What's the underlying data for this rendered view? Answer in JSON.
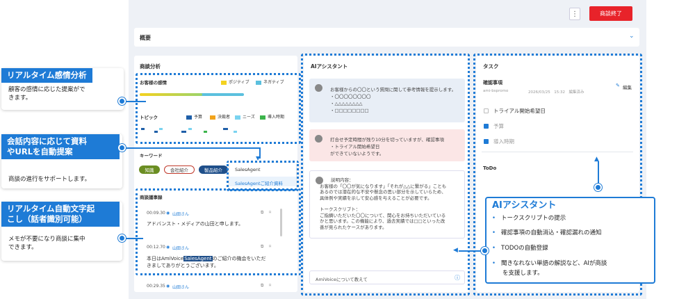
{
  "header": {
    "end_button": "商談終了",
    "overview_title": "概要"
  },
  "analysis": {
    "title": "商談分析",
    "emotion_label": "お客様の感情",
    "legend_positive": "ポジティブ",
    "legend_negative": "ネガティブ",
    "topic_label": "トピック",
    "topic_legend": [
      "予算",
      "決裁者",
      "ニーズ",
      "導入時期"
    ],
    "keyword_label": "キーワード",
    "chips": [
      "知識",
      "会社紹介",
      "製品紹介"
    ],
    "dropdown": [
      "SalesAgent",
      "SalesAgentご紹介資料"
    ]
  },
  "minutes": {
    "title": "商談議事録",
    "entries": [
      {
        "time": "00:09.30",
        "speaker": "山田さん",
        "text": "アドバンスト・メディアの山田と申します。"
      },
      {
        "time": "00:12.70",
        "speaker": "山田さん",
        "text_before": "本日はAmiVoice",
        "highlight": "SalesAgent",
        "text_after": "のご紹介の機会をいただ",
        "text2": "きましてありがとうございます。"
      },
      {
        "time": "00:29.35",
        "speaker": "山田さん"
      }
    ]
  },
  "assistant": {
    "title": "AIアシスタント",
    "msg1": [
      "お客様からの〇〇という質問に関して参考情報を提示します。",
      "・〇〇〇〇〇〇〇〇",
      "・△△△△△△△△",
      "・□□□□□□□□"
    ],
    "msg2": [
      "打合せ予定時間が残り10分を切っていますが、確認事項",
      "・トライアル開始希望日",
      "ができていないようです。"
    ],
    "msg3": [
      "説明内容：",
      "お客様の「〇〇が気になります」「それが△△に繋がる」ことも",
      "あるのでは潜在的な不安や懸念の思い部分を示していらため、",
      "具体例や実績を示して安心感を与えることが必要です。",
      "",
      "トークスクリプト：",
      "ご指摘いただいた〇〇について、関心をお持ちいただいている",
      "かと思います。この機能により、過去実績では□□といった改",
      "善が見られたケースがあります。"
    ],
    "input_placeholder": "AmiVoiceについて教えて"
  },
  "task": {
    "title": "タスク",
    "confirm_title": "確認事項",
    "edit_label": "編集",
    "meta_user": "ami-bspromo",
    "meta_date": "2026/03/25　15:32　編集済み",
    "items": [
      {
        "label": "トライアル開始希望日",
        "done": false
      },
      {
        "label": "予算",
        "done": true
      },
      {
        "label": "導入時期",
        "done": true
      }
    ],
    "todo_title": "ToDo"
  },
  "callouts": {
    "c1_title": "リアルタイム感情分析",
    "c1_body": [
      "顧客の感情に応じた提案がで",
      "きます。"
    ],
    "c2_title": [
      "会話内容に応じて資料",
      "やURLを自動提案"
    ],
    "c2_body": "商談の進行をサポートします。",
    "c3_title": [
      "リアルタイム自動文字起",
      "こし（話者識別可能）"
    ],
    "c3_body": [
      "メモが不要になり商談に集中",
      "できます。"
    ]
  },
  "ai_feature": {
    "title": "AIアシスタント",
    "items": [
      "トークスクリプトの提示",
      "確認事項の自動消込・確認漏れの通知",
      "TODOの自動登録",
      "聞きなれない単語の解説など、AIが商談",
      "を支援します。"
    ]
  },
  "colors": {
    "accent": "#1e7bd6",
    "end_button": "#e8232a",
    "positive": "#f4d21f",
    "negative": "#5bc0de",
    "budget": "#1f5fa8",
    "decision": "#f2a31b",
    "needs": "#7ad3f0",
    "timing": "#3cb44b"
  }
}
